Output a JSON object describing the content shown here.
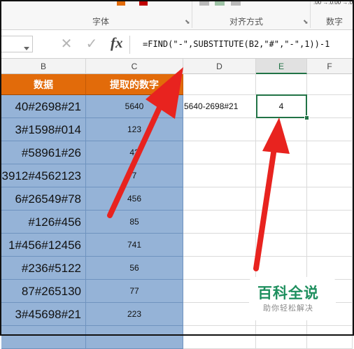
{
  "ribbon": {
    "group_font": "字体",
    "group_alignment": "对齐方式",
    "group_number": "数字",
    "number_format_increase": ".00 →.0",
    "number_format_decrease": ".00 →.0"
  },
  "formula_bar": {
    "cancel_icon": "✕",
    "enter_icon": "✓",
    "fx_label": "fx",
    "formula": "=FIND(\"-\",SUBSTITUTE(B2,\"#\",\"-\",1))-1"
  },
  "columns": [
    "B",
    "C",
    "D",
    "E",
    "F"
  ],
  "selected_column": "E",
  "header_row": {
    "b": "数据",
    "c": "提取的数字"
  },
  "rows": [
    {
      "b": "40#2698#21",
      "c": "5640"
    },
    {
      "b": "3#1598#014",
      "c": "123"
    },
    {
      "b": "#58961#26",
      "c": "42"
    },
    {
      "b": "3912#4562123",
      "c": "7"
    },
    {
      "b": "6#26549#78",
      "c": "456"
    },
    {
      "b": "#126#456",
      "c": "85"
    },
    {
      "b": "1#456#12456",
      "c": "741"
    },
    {
      "b": "#236#5122",
      "c": "56"
    },
    {
      "b": "87#265130",
      "c": "77"
    },
    {
      "b": "3#45698#21",
      "c": "223"
    },
    {
      "b": "",
      "c": ""
    }
  ],
  "cell_d2": "5640-2698#21",
  "cell_e2": "4",
  "watermark": {
    "main": "百科全说",
    "sub": "助你轻松解决"
  },
  "colors": {
    "header_orange": "#e26b0a",
    "data_blue": "#95b3d7",
    "arrow_red": "#e8231f",
    "excel_green": "#217346"
  },
  "icons": [
    "dropdown-arrow-icon",
    "cancel-icon",
    "enter-check-icon",
    "fx-icon",
    "dialog-launcher-icon"
  ]
}
